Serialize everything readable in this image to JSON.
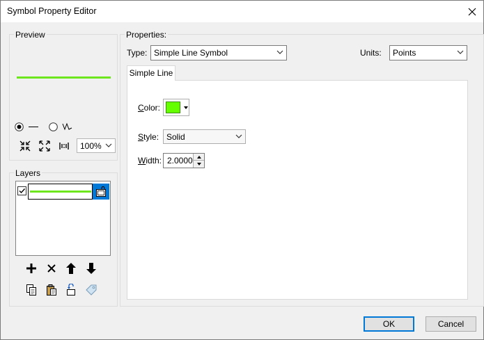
{
  "window": {
    "title": "Symbol Property Editor"
  },
  "preview": {
    "label": "Preview",
    "line_color": "#6ee61e",
    "zoom": "100%"
  },
  "layers": {
    "label": "Layers",
    "items": [
      {
        "checked": true,
        "color": "#6ee61e"
      }
    ]
  },
  "properties": {
    "label": "Properties:",
    "type_label": "Type:",
    "type_value": "Simple Line Symbol",
    "units_label": "Units:",
    "units_value": "Points",
    "tab_label": "Simple Line",
    "color_label_u": "C",
    "color_label_rest": "olor:",
    "color_value": "#66ff00",
    "style_label_u": "S",
    "style_label_rest": "tyle:",
    "style_value": "Solid",
    "width_label_u": "W",
    "width_label_rest": "idth:",
    "width_value": "2.0000"
  },
  "buttons": {
    "ok": "OK",
    "cancel": "Cancel"
  },
  "colors": {
    "accent": "#0078d7"
  }
}
